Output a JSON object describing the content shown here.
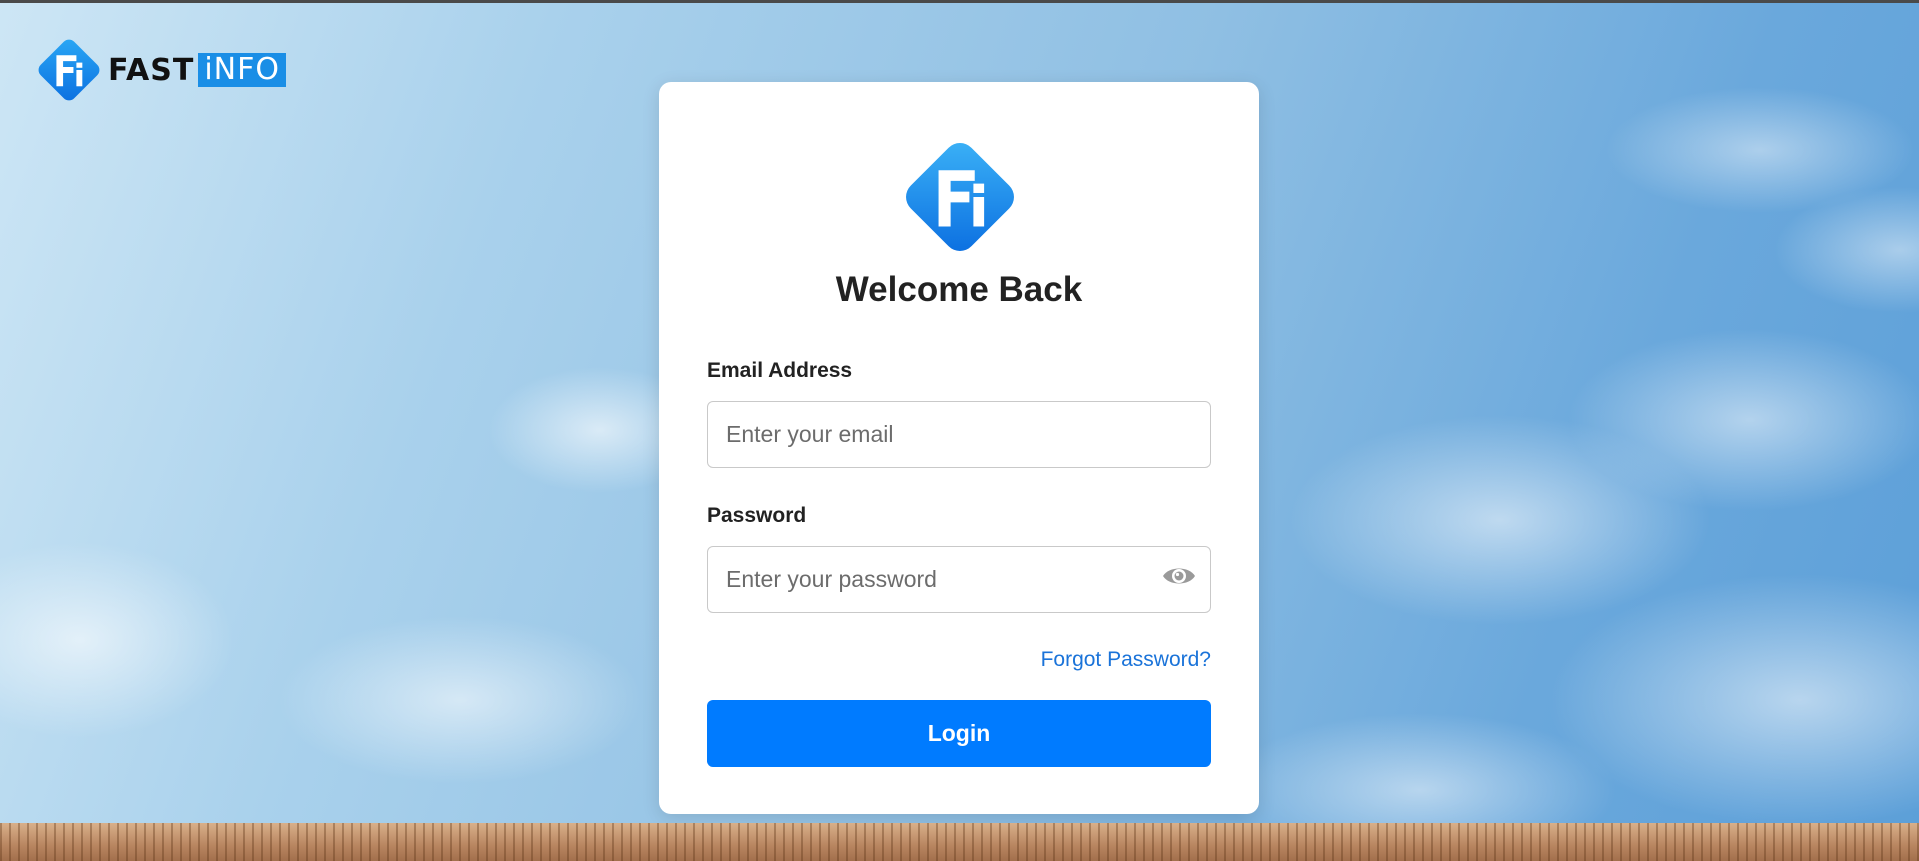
{
  "brand": {
    "name_part1": "FAST",
    "name_part2": "iNFO",
    "logo_icon": "fi-diamond-logo",
    "logo_letters": "Fi"
  },
  "colors": {
    "accent": "#007bff",
    "link": "#1a73d9",
    "brand_blue": "#1a8ee6"
  },
  "login_card": {
    "title": "Welcome Back",
    "email": {
      "label": "Email Address",
      "placeholder": "Enter your email",
      "value": ""
    },
    "password": {
      "label": "Password",
      "placeholder": "Enter your password",
      "value": "",
      "toggle_icon": "eye-icon"
    },
    "forgot_link": "Forgot Password?",
    "submit_label": "Login"
  }
}
